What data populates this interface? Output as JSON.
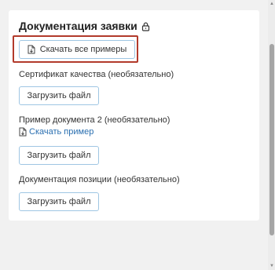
{
  "section": {
    "title": "Документация заявки",
    "download_all_label": "Скачать все примеры"
  },
  "fields": [
    {
      "label": "Сертификат качества (необязательно)",
      "upload_label": "Загрузить файл"
    },
    {
      "label": "Пример документа 2 (необязательно)",
      "link_label": "Скачать пример",
      "upload_label": "Загрузить файл"
    },
    {
      "label": "Документация позиции (необязательно)",
      "upload_label": "Загрузить файл"
    }
  ],
  "icons": {
    "title": "lock-icon",
    "download_all": "file-download-icon",
    "sample_link": "file-download-icon"
  },
  "colors": {
    "highlight_border": "#b23a2b",
    "button_border": "#9fc6e3",
    "link": "#2a6fb0",
    "background": "#f1f1f1",
    "card": "#ffffff"
  }
}
